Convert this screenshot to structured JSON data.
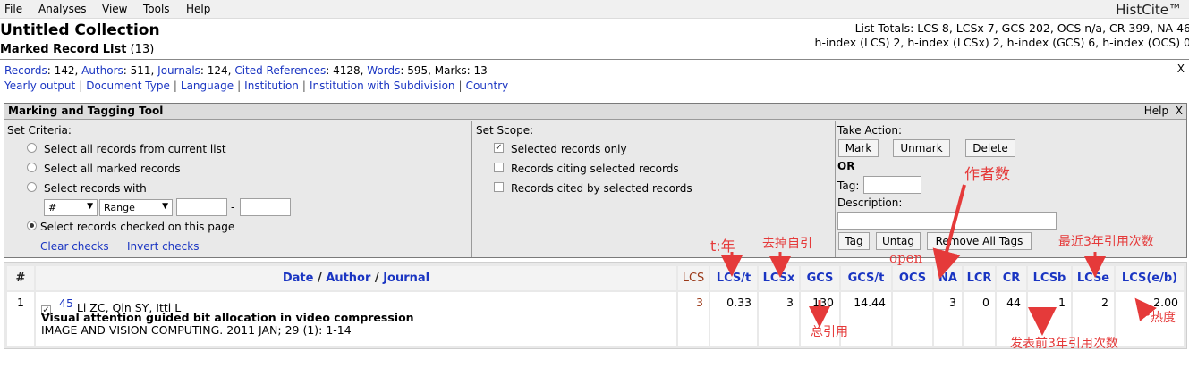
{
  "menu": [
    "File",
    "Analyses",
    "View",
    "Tools",
    "Help"
  ],
  "brand": "HistCite™",
  "collection_title": "Untitled Collection",
  "list_title": "Marked Record List",
  "list_count": "(13)",
  "totals_line1": "List Totals: LCS 8, LCSx 7, GCS 202, OCS n/a, CR 399, NA 46",
  "totals_line2": "h-index (LCS) 2, h-index (LCSx) 2, h-index (GCS) 6, h-index (OCS) 0",
  "stats": {
    "records_label": "Records",
    "records_value": ": 142, ",
    "authors_label": "Authors",
    "authors_value": ": 511, ",
    "journals_label": "Journals",
    "journals_value": ": 124, ",
    "cited_label": "Cited References",
    "cited_value": ": 4128, ",
    "words_label": "Words",
    "words_value": ": 595, ",
    "marks_text": "Marks: 13"
  },
  "links": [
    "Yearly output",
    "Document Type",
    "Language",
    "Institution",
    "Institution with Subdivision",
    "Country"
  ],
  "close_glyph": "X",
  "tool": {
    "title": "Marking and Tagging Tool",
    "help": "Help",
    "close": "X",
    "criteria_title": "Set Criteria:",
    "criteria": [
      "Select all records from current list",
      "Select all marked records",
      "Select records with",
      "Select records checked on this page"
    ],
    "field_select": "#",
    "range_select": "Range",
    "dash": "-",
    "clear_checks": "Clear checks",
    "invert_checks": "Invert checks",
    "scope_title": "Set Scope:",
    "scope": [
      "Selected records only",
      "Records citing selected records",
      "Records cited by selected records"
    ],
    "action_title": "Take Action:",
    "mark": "Mark",
    "unmark": "Unmark",
    "delete": "Delete",
    "or": "OR",
    "tag_label": "Tag:",
    "description_label": "Description:",
    "tag_btn": "Tag",
    "untag_btn": "Untag",
    "remove_tags_btn": "Remove All Tags"
  },
  "table": {
    "headers": {
      "num": "#",
      "date": "Date",
      "slash1": " / ",
      "author": "Author",
      "slash2": " / ",
      "journal": "Journal",
      "lcs": "LCS",
      "lcst": "LCS/t",
      "lcsx": "LCSx",
      "gcs": "GCS",
      "gcst": "GCS/t",
      "ocs": "OCS",
      "na": "NA",
      "lcr": "LCR",
      "cr": "CR",
      "lcsb": "LCSb",
      "lcse": "LCSe",
      "lcseb": "LCS(e/b)"
    },
    "row": {
      "num": "1",
      "record_no": "45",
      "authors": "Li ZC, Qin SY, Itti L",
      "title": "Visual attention guided bit allocation in video compression",
      "source": "IMAGE AND VISION COMPUTING. 2011 JAN; 29 (1): 1-14",
      "lcs": "3",
      "lcst": "0.33",
      "lcsx": "3",
      "gcs": "130",
      "gcst": "14.44",
      "ocs": "",
      "na": "3",
      "lcr": "0",
      "cr": "44",
      "lcsb": "1",
      "lcse": "2",
      "lcseb": "2.00"
    }
  },
  "annotations": {
    "t_year": "t:年",
    "remove_self": "去掉自引",
    "open": "open",
    "author_count": "作者数",
    "recent3": "最近3年引用次数",
    "total_cite": "总引用",
    "heat": "热度",
    "first3": "发表前3年引用次数"
  },
  "colors": {
    "link": "#1a35c2",
    "annotation": "#e53a3a",
    "lcs_value": "#9b3a1a"
  }
}
